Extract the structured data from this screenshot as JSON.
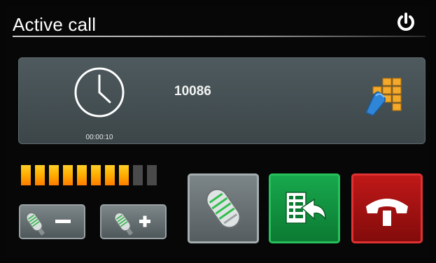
{
  "header": {
    "title": "Active call"
  },
  "call": {
    "number": "10086",
    "duration": "00:00:10"
  },
  "microphone_level": {
    "active": 8,
    "total": 10
  },
  "colors": {
    "level_on": "#ffb000",
    "transfer_green": "#0c7a33",
    "hangup_red": "#a31212",
    "panel": "#465155"
  },
  "icons": {
    "power": "power-icon",
    "clock": "clock-icon",
    "keypad": "keypad-icon",
    "mic_minus": "microphone-minus-icon",
    "mic_plus": "microphone-plus-icon",
    "mic": "microphone-icon",
    "transfer": "transfer-icon",
    "hangup": "hang-up-icon"
  }
}
